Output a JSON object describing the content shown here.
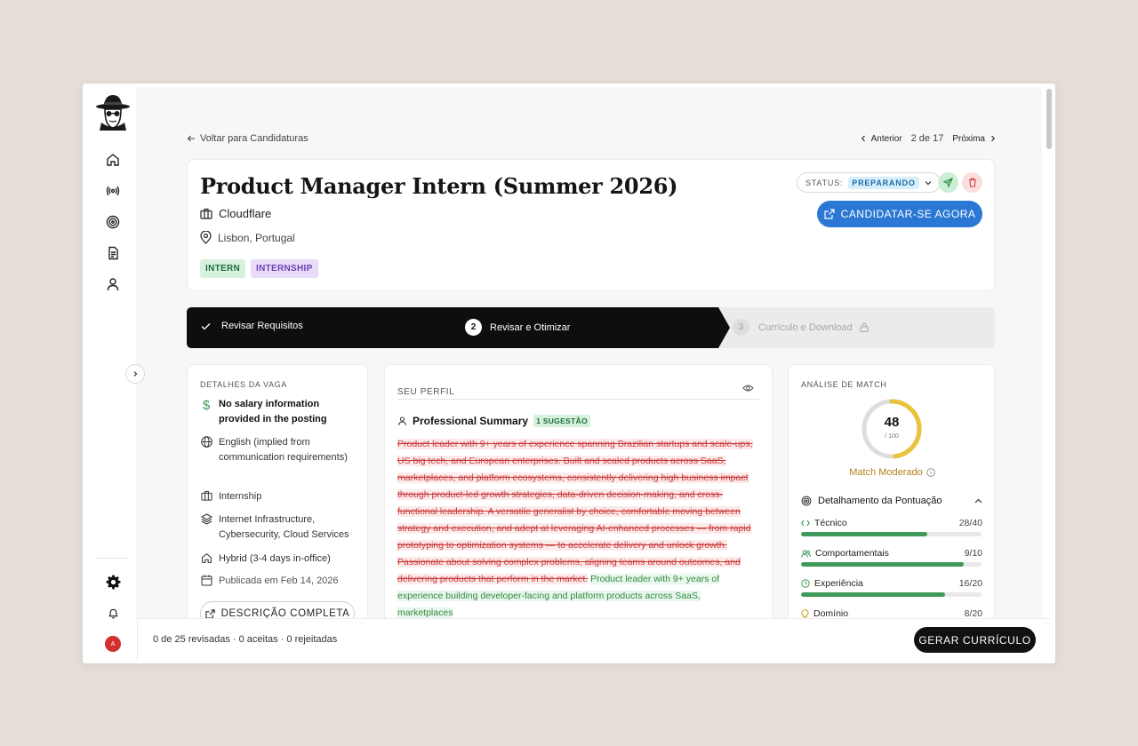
{
  "navigation": {
    "back_label": "Voltar para Candidaturas",
    "prev_label": "Anterior",
    "position": "2 de 17",
    "next_label": "Próxima"
  },
  "job": {
    "title": "Product Manager Intern (Summer 2026)",
    "company": "Cloudflare",
    "location": "Lisbon, Portugal",
    "tags": [
      "INTERN",
      "INTERNSHIP"
    ],
    "status_label": "STATUS:",
    "status_value": "PREPARANDO",
    "apply_label": "CANDIDATAR-SE AGORA"
  },
  "steps": [
    {
      "label": "Revisar Requisitos",
      "state": "done"
    },
    {
      "number": "2",
      "label": "Revisar e Otimizar",
      "state": "active"
    },
    {
      "number": "3",
      "label": "Currículo e Download",
      "state": "locked"
    }
  ],
  "details": {
    "heading": "DETALHES DA VAGA",
    "salary": "No salary information provided in the posting",
    "language": "English (implied from communication requirements)",
    "type": "Internship",
    "industry": "Internet Infrastructure, Cybersecurity, Cloud Services",
    "work_mode": "Hybrid (3-4 days in-office)",
    "published": "Publicada em Feb 14, 2026",
    "description_button": "DESCRIÇÃO COMPLETA"
  },
  "profile": {
    "heading": "SEU PERFIL",
    "section_title": "Professional Summary",
    "suggestion_badge": "1 SUGESTÃO",
    "removed_text": "Product leader with 9+ years of experience spanning Brazilian startups and scale-ups, US big tech, and European enterprises. Built and scaled products across SaaS, marketplaces, and platform ecosystems, consistently delivering high business impact through product-led growth strategies, data-driven decision-making, and cross-functional leadership. A versatile generalist by choice, comfortable moving between strategy and execution, and adept at leveraging AI-enhanced processes — from rapid prototyping to optimization systems — to accelerate delivery and unlock growth. Passionate about solving complex problems, aligning teams around outcomes, and delivering products that perform in the market.",
    "added_text": "Product leader with 9+ years of experience building developer-facing and platform products across SaaS, marketplaces"
  },
  "match": {
    "heading": "ANÁLISE DE MATCH",
    "score": "48",
    "score_max": "/ 100",
    "score_value": 48,
    "label": "Match Moderado",
    "breakdown_title": "Detalhamento da Pontuação",
    "rows": [
      {
        "name": "Técnico",
        "value": "28/40",
        "fraction": 0.7,
        "icon": "code-icon"
      },
      {
        "name": "Comportamentais",
        "value": "9/10",
        "fraction": 0.9,
        "icon": "users-icon"
      },
      {
        "name": "Experiência",
        "value": "16/20",
        "fraction": 0.8,
        "icon": "clock-icon"
      },
      {
        "name": "Domínio",
        "value": "8/20",
        "fraction": 0.4,
        "icon": "lightbulb-icon"
      }
    ]
  },
  "footer": {
    "stats": "0 de 25 revisadas · 0 aceitas · 0 rejeitadas",
    "generate_label": "GERAR CURRÍCULO"
  },
  "user": {
    "avatar_initial": "A"
  },
  "colors": {
    "accent_blue": "#2a78d4",
    "success_green": "#3f9a5a",
    "gauge_yellow": "#e9c33b",
    "match_amber": "#b0801a",
    "diff_removed": "#c83a3a",
    "diff_added": "#2f8a3f"
  }
}
